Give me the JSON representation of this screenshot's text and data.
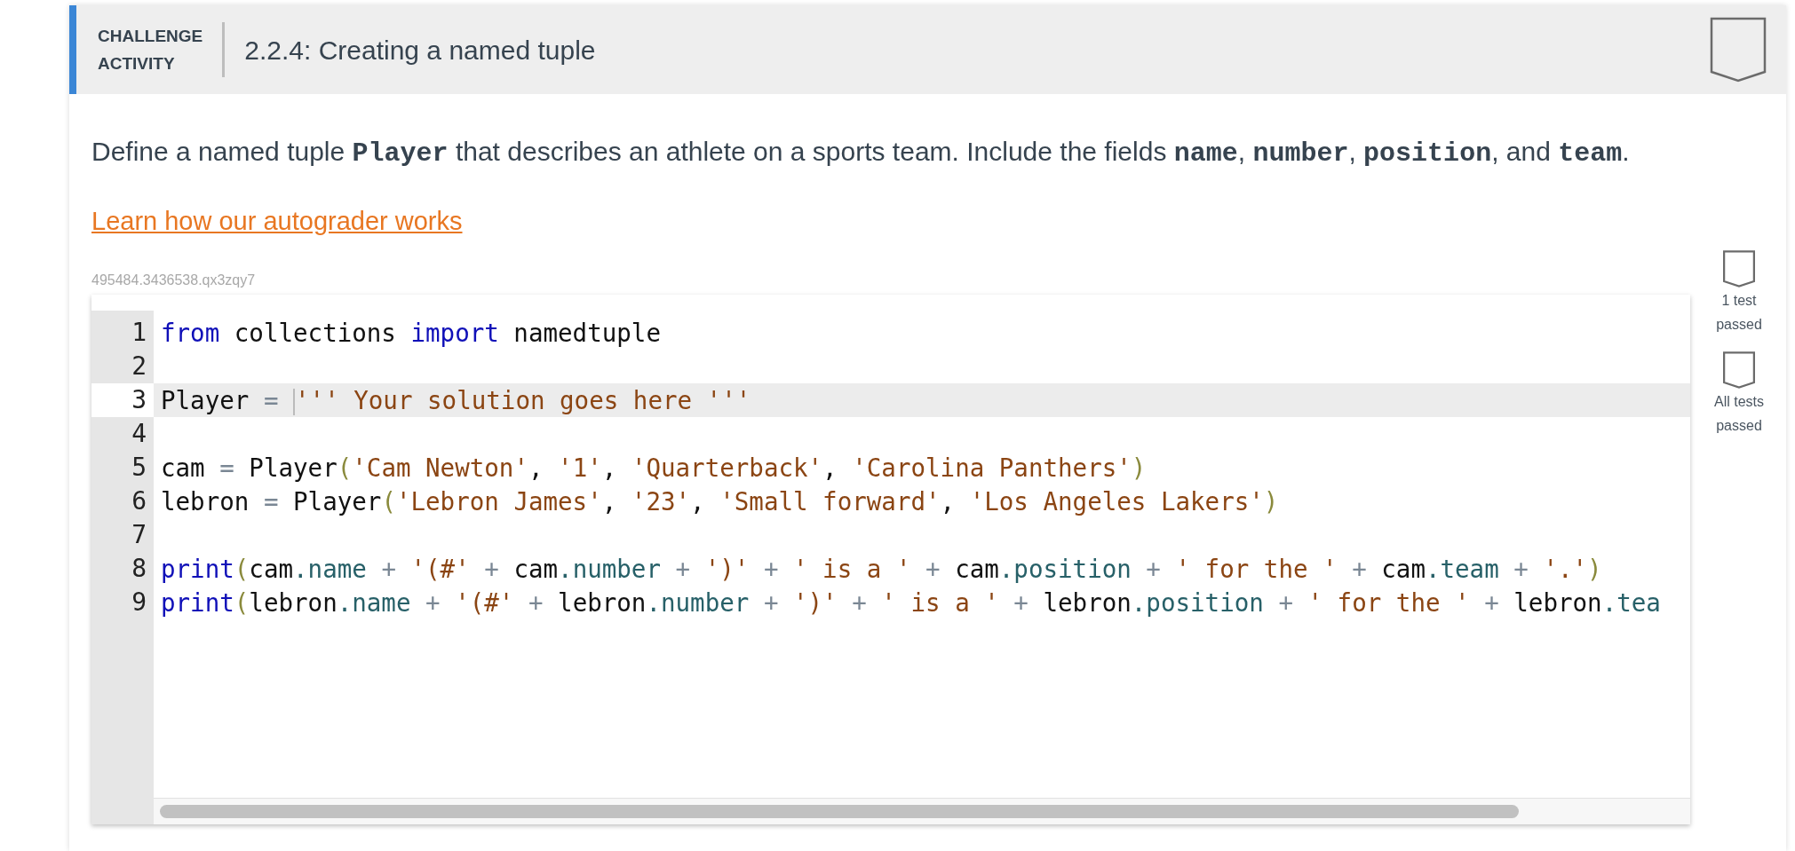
{
  "header": {
    "label_lines": [
      "CHALLENGE",
      "ACTIVITY"
    ],
    "title": "2.2.4: Creating a named tuple",
    "completed": false
  },
  "description": [
    {
      "kind": "text",
      "text": "Define a named tuple "
    },
    {
      "kind": "code",
      "text": "Player"
    },
    {
      "kind": "text",
      "text": " that describes an athlete on a sports team. Include the fields "
    },
    {
      "kind": "code",
      "text": "name"
    },
    {
      "kind": "text",
      "text": ", "
    },
    {
      "kind": "code",
      "text": "number"
    },
    {
      "kind": "text",
      "text": ", "
    },
    {
      "kind": "code",
      "text": "position"
    },
    {
      "kind": "text",
      "text": ", and "
    },
    {
      "kind": "code",
      "text": "team"
    },
    {
      "kind": "text",
      "text": "."
    }
  ],
  "link": "Learn how our autograder works",
  "activity_id": "495484.3436538.qx3zqy7",
  "editor": {
    "lines": [
      {
        "number": "1",
        "active": false,
        "tokens": [
          {
            "kind": "keyword",
            "text": "from"
          },
          {
            "kind": "plain",
            "text": " collections "
          },
          {
            "kind": "keyword",
            "text": "import"
          },
          {
            "kind": "plain",
            "text": " namedtuple"
          }
        ]
      },
      {
        "number": "2",
        "active": false
      },
      {
        "number": "3",
        "active": true,
        "tokens": [
          {
            "kind": "plain",
            "text": "Player "
          },
          {
            "kind": "operator",
            "text": "= "
          },
          {
            "kind": "string",
            "text": "''' Your solution goes here '''",
            "cursor": true
          }
        ]
      },
      {
        "number": "4",
        "active": false
      },
      {
        "number": "5",
        "active": false,
        "tokens": [
          {
            "kind": "plain",
            "text": "cam "
          },
          {
            "kind": "operator",
            "text": "= "
          },
          {
            "kind": "plain",
            "text": "Player"
          },
          {
            "kind": "paren",
            "text": "("
          },
          {
            "kind": "string",
            "text": "'Cam Newton'"
          },
          {
            "kind": "plain",
            "text": ", "
          },
          {
            "kind": "string",
            "text": "'1'"
          },
          {
            "kind": "plain",
            "text": ", "
          },
          {
            "kind": "string",
            "text": "'Quarterback'"
          },
          {
            "kind": "plain",
            "text": ", "
          },
          {
            "kind": "string",
            "text": "'Carolina Panthers'"
          },
          {
            "kind": "paren",
            "text": ")"
          }
        ]
      },
      {
        "number": "6",
        "active": false,
        "tokens": [
          {
            "kind": "plain",
            "text": "lebron "
          },
          {
            "kind": "operator",
            "text": "= "
          },
          {
            "kind": "plain",
            "text": "Player"
          },
          {
            "kind": "paren",
            "text": "("
          },
          {
            "kind": "string",
            "text": "'Lebron James'"
          },
          {
            "kind": "plain",
            "text": ", "
          },
          {
            "kind": "string",
            "text": "'23'"
          },
          {
            "kind": "plain",
            "text": ", "
          },
          {
            "kind": "string",
            "text": "'Small forward'"
          },
          {
            "kind": "plain",
            "text": ", "
          },
          {
            "kind": "string",
            "text": "'Los Angeles Lakers'"
          },
          {
            "kind": "paren",
            "text": ")"
          }
        ]
      },
      {
        "number": "7",
        "active": false
      },
      {
        "number": "8",
        "active": false,
        "tokens": [
          {
            "kind": "keyword",
            "text": "print"
          },
          {
            "kind": "paren",
            "text": "("
          },
          {
            "kind": "plain",
            "text": "cam"
          },
          {
            "kind": "property",
            "text": ".name"
          },
          {
            "kind": "operator",
            "text": " + "
          },
          {
            "kind": "string",
            "text": "'(#'"
          },
          {
            "kind": "operator",
            "text": " + "
          },
          {
            "kind": "plain",
            "text": "cam"
          },
          {
            "kind": "property",
            "text": ".number"
          },
          {
            "kind": "operator",
            "text": " + "
          },
          {
            "kind": "string",
            "text": "')'"
          },
          {
            "kind": "operator",
            "text": " + "
          },
          {
            "kind": "string",
            "text": "' is a '"
          },
          {
            "kind": "operator",
            "text": " + "
          },
          {
            "kind": "plain",
            "text": "cam"
          },
          {
            "kind": "property",
            "text": ".position"
          },
          {
            "kind": "operator",
            "text": " + "
          },
          {
            "kind": "string",
            "text": "' for the '"
          },
          {
            "kind": "operator",
            "text": " + "
          },
          {
            "kind": "plain",
            "text": "cam"
          },
          {
            "kind": "property",
            "text": ".team"
          },
          {
            "kind": "operator",
            "text": " + "
          },
          {
            "kind": "string",
            "text": "'.'"
          },
          {
            "kind": "paren",
            "text": ")"
          }
        ]
      },
      {
        "number": "9",
        "active": false,
        "tokens": [
          {
            "kind": "keyword",
            "text": "print"
          },
          {
            "kind": "paren",
            "text": "("
          },
          {
            "kind": "plain",
            "text": "lebron"
          },
          {
            "kind": "property",
            "text": ".name"
          },
          {
            "kind": "operator",
            "text": " + "
          },
          {
            "kind": "string",
            "text": "'(#'"
          },
          {
            "kind": "operator",
            "text": " + "
          },
          {
            "kind": "plain",
            "text": "lebron"
          },
          {
            "kind": "property",
            "text": ".number"
          },
          {
            "kind": "operator",
            "text": " + "
          },
          {
            "kind": "string",
            "text": "')'"
          },
          {
            "kind": "operator",
            "text": " + "
          },
          {
            "kind": "string",
            "text": "' is a '"
          },
          {
            "kind": "operator",
            "text": " + "
          },
          {
            "kind": "plain",
            "text": "lebron"
          },
          {
            "kind": "property",
            "text": ".position"
          },
          {
            "kind": "operator",
            "text": " + "
          },
          {
            "kind": "string",
            "text": "' for the '"
          },
          {
            "kind": "operator",
            "text": " + "
          },
          {
            "kind": "plain",
            "text": "lebron"
          },
          {
            "kind": "property",
            "text": ".tea"
          }
        ]
      }
    ]
  },
  "tests": [
    {
      "label_lines": [
        "1 test",
        "passed"
      ],
      "passed": false
    },
    {
      "label_lines": [
        "All tests",
        "passed"
      ],
      "passed": false
    }
  ]
}
